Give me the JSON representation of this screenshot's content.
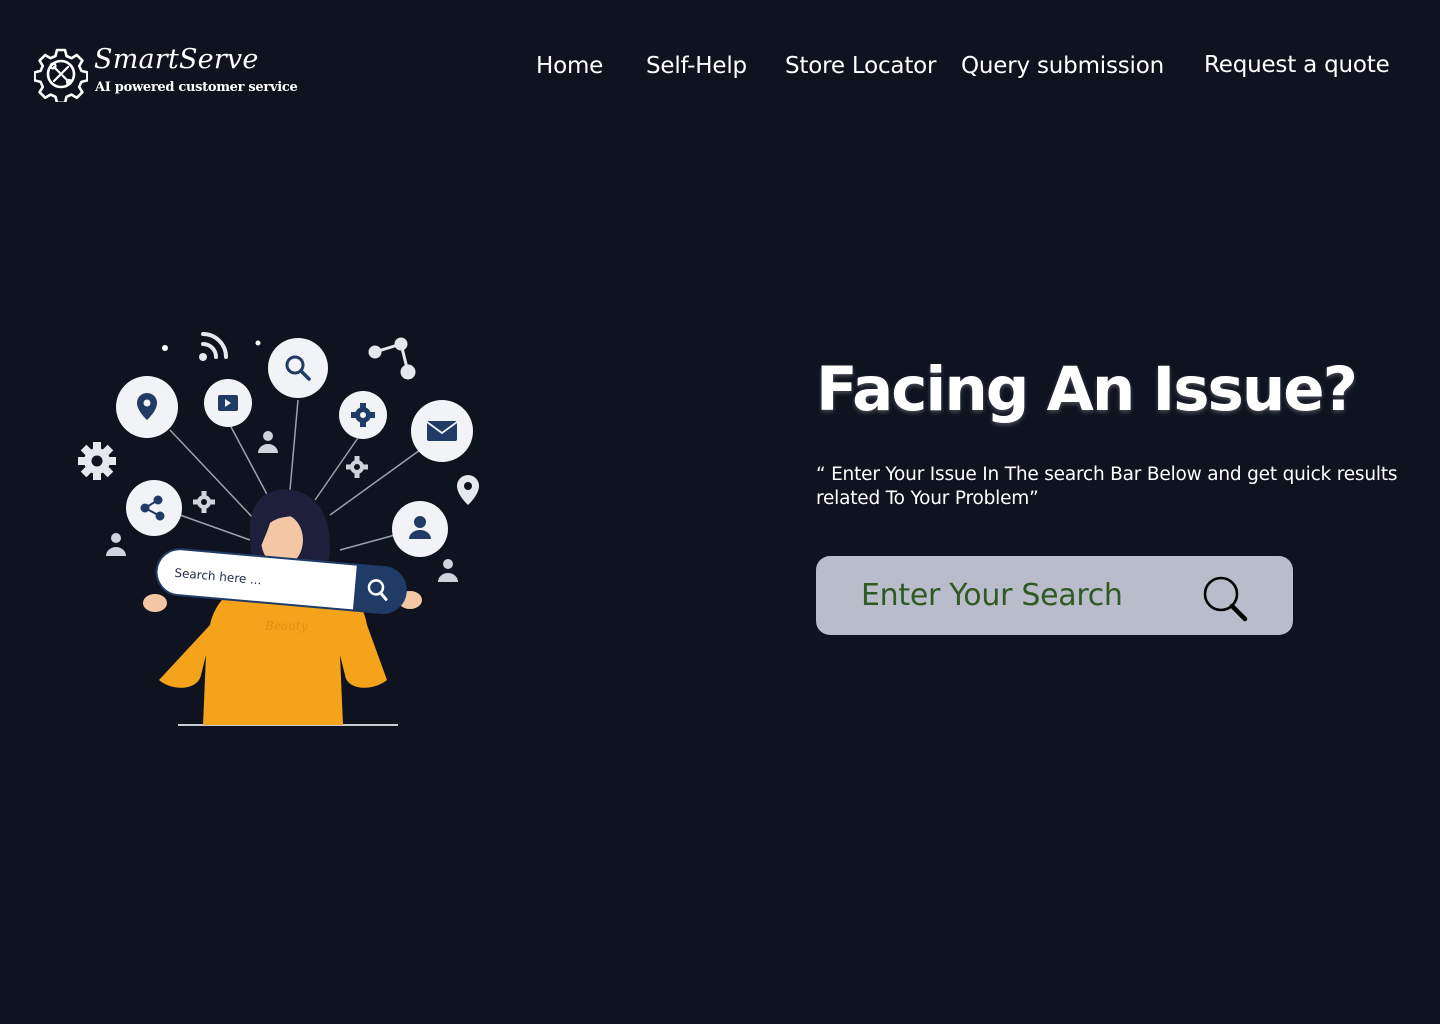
{
  "brand": {
    "name": "SmartServe",
    "tagline": "AI powered customer service",
    "icon": "gear-tools-icon"
  },
  "nav": {
    "items": [
      {
        "label": "Home"
      },
      {
        "label": "Self-Help"
      },
      {
        "label": "Store Locator"
      },
      {
        "label": "Query submission"
      },
      {
        "label": "Request a quote"
      }
    ]
  },
  "illustration": {
    "search_label": "Search here ...",
    "shirt_text": "Beauty",
    "icons": [
      "wifi-icon",
      "search-icon",
      "network-icon",
      "location-pin-icon",
      "video-icon",
      "user-icon",
      "gear-icon",
      "mail-icon",
      "share-icon"
    ]
  },
  "hero": {
    "title": "Facing An Issue?",
    "subtitle": "“ Enter Your Issue In The search Bar Below and get quick results related To Your Problem”"
  },
  "search": {
    "placeholder": "Enter Your Search",
    "value": "",
    "button_icon": "search-icon"
  },
  "colors": {
    "background": "#0f1320",
    "search_box": "#b9bcca",
    "search_text": "#2f5a23",
    "illustration_accent": "#f5a31a",
    "illustration_navy": "#1f3b66"
  }
}
